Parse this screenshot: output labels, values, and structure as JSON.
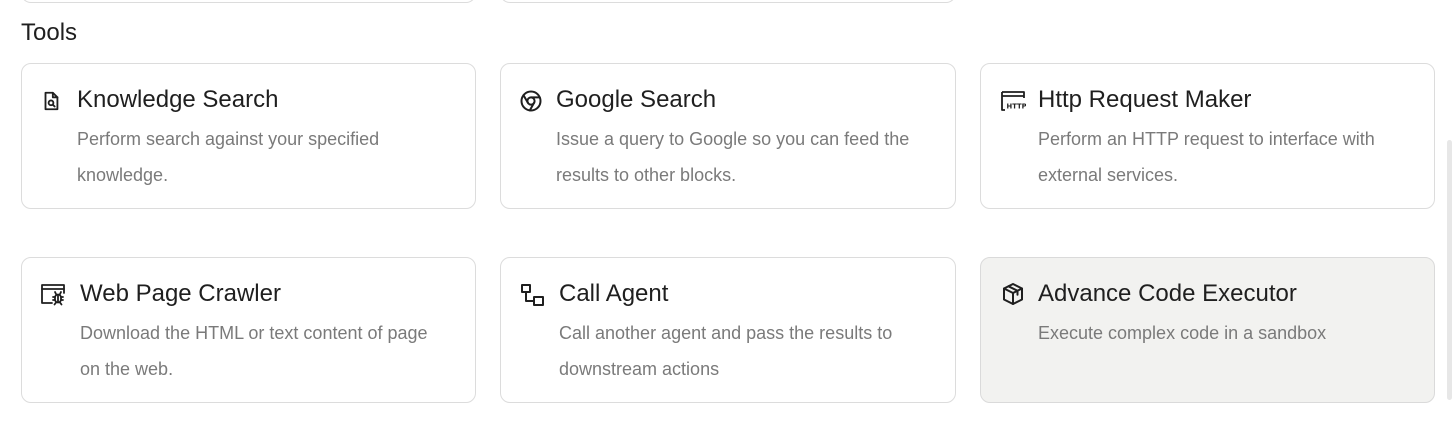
{
  "section": {
    "title": "Tools"
  },
  "tools": [
    {
      "title": "Knowledge Search",
      "description": "Perform search against your specified knowledge.",
      "icon": "document-search-icon"
    },
    {
      "title": "Google Search",
      "description": "Issue a query to Google so you can feed the results to other blocks.",
      "icon": "chrome-icon"
    },
    {
      "title": "Http Request Maker",
      "description": "Perform an HTTP request to interface with external services.",
      "icon": "http-icon"
    },
    {
      "title": "Web Page Crawler",
      "description": "Download the HTML or text content of page on the web.",
      "icon": "web-crawler-icon"
    },
    {
      "title": "Call Agent",
      "description": "Call another agent and pass the results to downstream actions",
      "icon": "flow-nodes-icon"
    },
    {
      "title": "Advance Code Executor",
      "description": "Execute complex code in a sandbox",
      "icon": "package-icon"
    }
  ],
  "colors": {
    "card_border": "#dcdcdc",
    "card_hover_bg": "#f2f2f0",
    "title_text": "#1f1f1f",
    "description_text": "#7a7a7a"
  }
}
